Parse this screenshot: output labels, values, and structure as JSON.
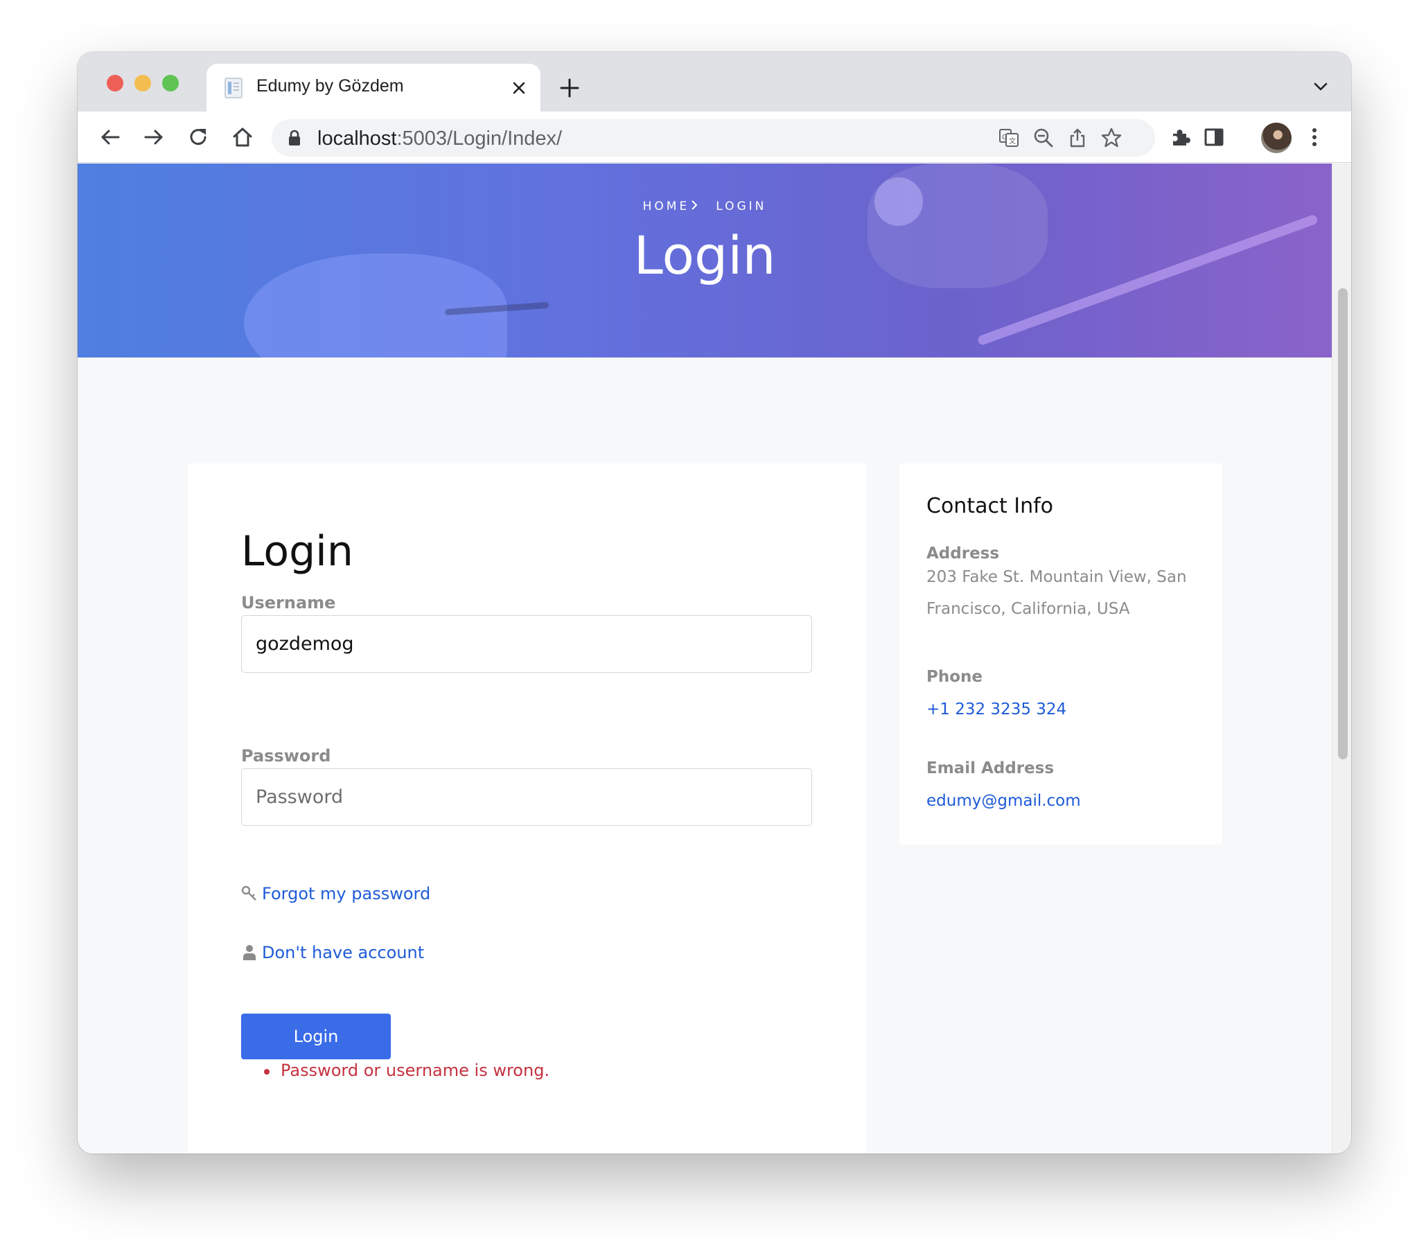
{
  "browser": {
    "tab_title": "Edumy by Gözdem",
    "url_host": "localhost",
    "url_path": ":5003/Login/Index/"
  },
  "hero": {
    "crumb_home": "HOME",
    "crumb_current": "LOGIN",
    "title": "Login"
  },
  "login": {
    "title": "Login",
    "username_label": "Username",
    "username_value": "gozdemog",
    "password_label": "Password",
    "password_placeholder": "Password",
    "forgot_link": "Forgot my password",
    "register_link": "Don't have account",
    "submit_label": "Login",
    "errors": [
      "Password or username is wrong."
    ]
  },
  "contact": {
    "title": "Contact Info",
    "address_label": "Address",
    "address": "203 Fake St. Mountain View, San Francisco, California, USA",
    "phone_label": "Phone",
    "phone": "+1 232 3235 324",
    "email_label": "Email Address",
    "email": "edumy@gmail.com"
  },
  "colors": {
    "accent": "#3a6ce8",
    "link": "#1e5bd8",
    "error": "#c4313f"
  }
}
